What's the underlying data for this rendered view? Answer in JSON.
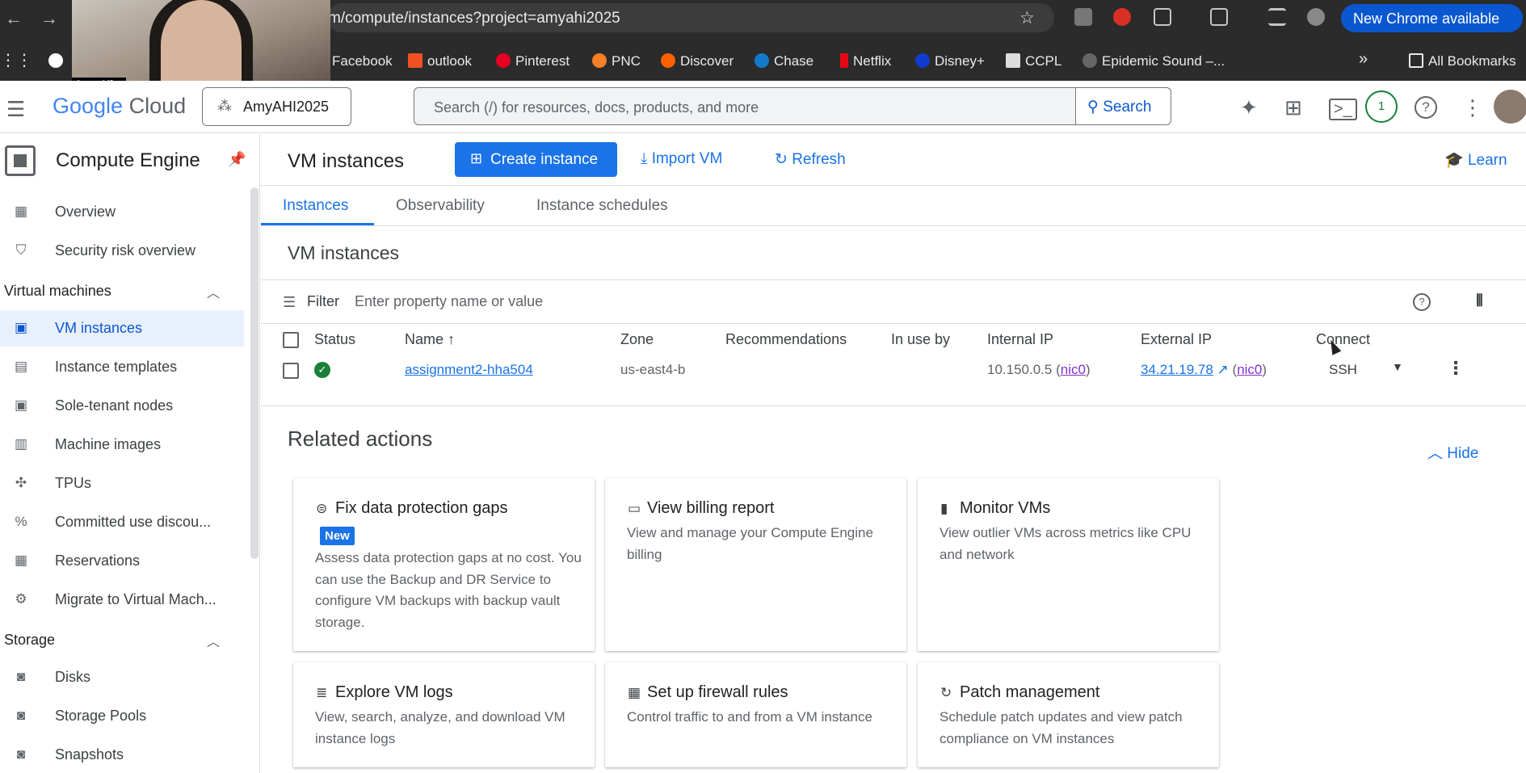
{
  "browser": {
    "url": "m/compute/instances?project=amyahi2025",
    "update_button": "New Chrome available",
    "bookmarks": [
      "Facebook",
      "outlook",
      "Pinterest",
      "PNC",
      "Discover",
      "Chase",
      "Netflix",
      "Disney+",
      "CCPL",
      "Epidemic Sound –..."
    ],
    "all_bookmarks": "All Bookmarks",
    "more": "»"
  },
  "webcam": {
    "name": "Amy Kim"
  },
  "header": {
    "logo_google": "Google",
    "logo_cloud": " Cloud",
    "project": "AmyAHI2025",
    "search_placeholder": "Search (/) for resources, docs, products, and more",
    "search_button": "Search",
    "notification_count": "1"
  },
  "sidebar": {
    "title": "Compute Engine",
    "items_top": [
      {
        "label": "Overview",
        "icon": "dashboard-icon"
      },
      {
        "label": "Security risk overview",
        "icon": "shield-icon"
      }
    ],
    "section_vm": "Virtual machines",
    "items_vm": [
      {
        "label": "VM instances",
        "icon": "vm-icon"
      },
      {
        "label": "Instance templates",
        "icon": "template-icon"
      },
      {
        "label": "Sole-tenant nodes",
        "icon": "node-icon"
      },
      {
        "label": "Machine images",
        "icon": "image-icon"
      },
      {
        "label": "TPUs",
        "icon": "tpu-icon"
      },
      {
        "label": "Committed use discou...",
        "icon": "percent-icon"
      },
      {
        "label": "Reservations",
        "icon": "calendar-icon"
      },
      {
        "label": "Migrate to Virtual Mach...",
        "icon": "migrate-icon"
      }
    ],
    "section_storage": "Storage",
    "items_storage": [
      {
        "label": "Disks",
        "icon": "disk-icon"
      },
      {
        "label": "Storage Pools",
        "icon": "pool-icon"
      },
      {
        "label": "Snapshots",
        "icon": "snapshot-icon"
      }
    ]
  },
  "main": {
    "title": "VM instances",
    "create_button": "Create instance",
    "import_button": "Import VM",
    "refresh_button": "Refresh",
    "learn_button": "Learn",
    "tabs": [
      "Instances",
      "Observability",
      "Instance schedules"
    ],
    "section_title": "VM instances",
    "filter_label": "Filter",
    "filter_placeholder": "Enter property name or value",
    "columns": [
      "Status",
      "Name",
      "Zone",
      "Recommendations",
      "In use by",
      "Internal IP",
      "External IP",
      "Connect"
    ],
    "rows": [
      {
        "name": "assignment2-hha504",
        "zone": "us-east4-b",
        "internal_ip": "10.150.0.5",
        "internal_nic": "nic0",
        "external_ip": "34.21.19.78",
        "external_nic": "nic0",
        "connect": "SSH"
      }
    ],
    "related_title": "Related actions",
    "hide_button": "Hide",
    "cards": [
      {
        "title": "Fix data protection gaps",
        "badge": "New",
        "body": "Assess data protection gaps at no cost. You can use the Backup and DR Service to configure VM backups with backup vault storage.",
        "icon": "protection-icon"
      },
      {
        "title": "View billing report",
        "body": "View and manage your Compute Engine billing",
        "icon": "billing-icon"
      },
      {
        "title": "Monitor VMs",
        "body": "View outlier VMs across metrics like CPU and network",
        "icon": "bar-chart-icon"
      },
      {
        "title": "Explore VM logs",
        "body": "View, search, analyze, and download VM instance logs",
        "icon": "logs-icon"
      },
      {
        "title": "Set up firewall rules",
        "body": "Control traffic to and from a VM instance",
        "icon": "firewall-icon"
      },
      {
        "title": "Patch management",
        "body": "Schedule patch updates and view patch compliance on VM instances",
        "icon": "patch-icon"
      }
    ]
  }
}
